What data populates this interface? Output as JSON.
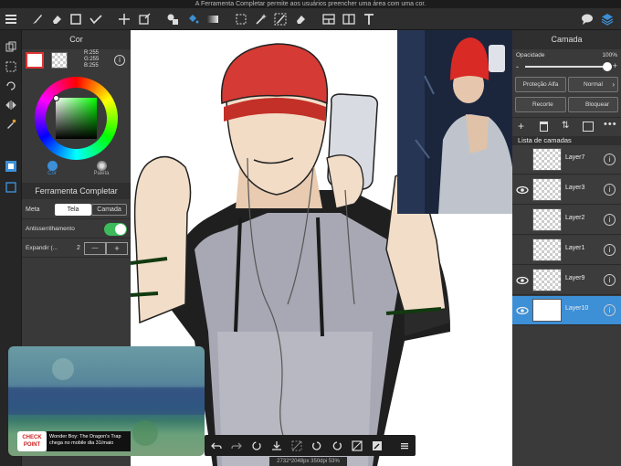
{
  "hint": "A Ferramenta Completar permite aos usuários preencher uma área com uma cor.",
  "color_panel": {
    "title": "Cor",
    "r": "R:255",
    "g": "G:255",
    "b": "B:255",
    "tab_color": "Cor",
    "tab_palette": "Paleta",
    "tool_title": "Ferramenta Completar",
    "target_label": "Meta",
    "target_canvas": "Tela",
    "target_layer": "Camada",
    "antialias_label": "Antisserrilhamento",
    "expand_label": "Expandir (...",
    "expand_value": "2",
    "minus": "—",
    "plus": "+"
  },
  "layer_panel": {
    "title": "Camada",
    "opacity_label": "Opacidade",
    "opacity_value": "100%",
    "opacity_fraction": 1.0,
    "alpha_protect": "Proteção Alfa",
    "blend_mode": "Normal",
    "clipping": "Recorte",
    "lock": "Bloquear",
    "list_title": "Lista de camadas",
    "layers": [
      {
        "name": "Layer7",
        "visible": false,
        "selected": false
      },
      {
        "name": "Layer3",
        "visible": true,
        "selected": false
      },
      {
        "name": "Layer2",
        "visible": false,
        "selected": false
      },
      {
        "name": "Layer1",
        "visible": false,
        "selected": false
      },
      {
        "name": "Layer9",
        "visible": true,
        "selected": false
      },
      {
        "name": "Layer10",
        "visible": true,
        "selected": true
      }
    ]
  },
  "status": "2732*2048px 350dpi 53%",
  "ad": {
    "logo": "CHECK POINT",
    "headline": "Wonder Boy: The Dragon's Trap chega no mobile dia 31/maio"
  },
  "colors": {
    "accent": "#3d8fd6",
    "toggle_on": "#3dbb5b",
    "primary": "#ffffff"
  }
}
